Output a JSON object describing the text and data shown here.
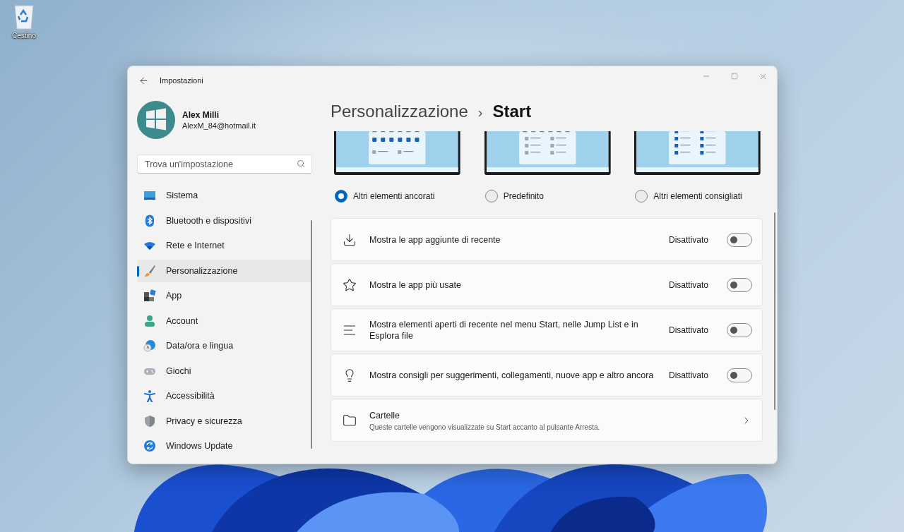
{
  "desktop": {
    "icons": [
      {
        "label": "Cestino"
      }
    ]
  },
  "window": {
    "title": "Impostazioni"
  },
  "profile": {
    "name": "Alex Milli",
    "email": "AlexM_84@hotmail.it"
  },
  "search": {
    "placeholder": "Trova un'impostazione"
  },
  "nav": [
    {
      "label": "Sistema",
      "selected": false
    },
    {
      "label": "Bluetooth e dispositivi",
      "selected": false
    },
    {
      "label": "Rete e Internet",
      "selected": false
    },
    {
      "label": "Personalizzazione",
      "selected": true
    },
    {
      "label": "App",
      "selected": false
    },
    {
      "label": "Account",
      "selected": false
    },
    {
      "label": "Data/ora e lingua",
      "selected": false
    },
    {
      "label": "Giochi",
      "selected": false
    },
    {
      "label": "Accessibilità",
      "selected": false
    },
    {
      "label": "Privacy e sicurezza",
      "selected": false
    },
    {
      "label": "Windows Update",
      "selected": false
    }
  ],
  "breadcrumb": {
    "parent": "Personalizzazione",
    "separator": "›",
    "current": "Start"
  },
  "layouts": [
    {
      "label": "Altri elementi ancorati",
      "selected": true
    },
    {
      "label": "Predefinito",
      "selected": false
    },
    {
      "label": "Altri elementi consigliati",
      "selected": false
    }
  ],
  "settings": [
    {
      "kind": "toggle",
      "label": "Mostra le app aggiunte di recente",
      "state_text": "Disattivato",
      "on": false
    },
    {
      "kind": "toggle",
      "label": "Mostra le app più usate",
      "state_text": "Disattivato",
      "on": false
    },
    {
      "kind": "toggle",
      "label": "Mostra elementi aperti di recente nel menu Start, nelle Jump List e in Esplora file",
      "state_text": "Disattivato",
      "on": false
    },
    {
      "kind": "toggle",
      "label": "Mostra consigli per suggerimenti, collegamenti, nuove app e altro ancora",
      "state_text": "Disattivato",
      "on": false
    },
    {
      "kind": "link",
      "label": "Cartelle",
      "description": "Queste cartelle vengono visualizzate su Start accanto al pulsante Arresta."
    }
  ]
}
